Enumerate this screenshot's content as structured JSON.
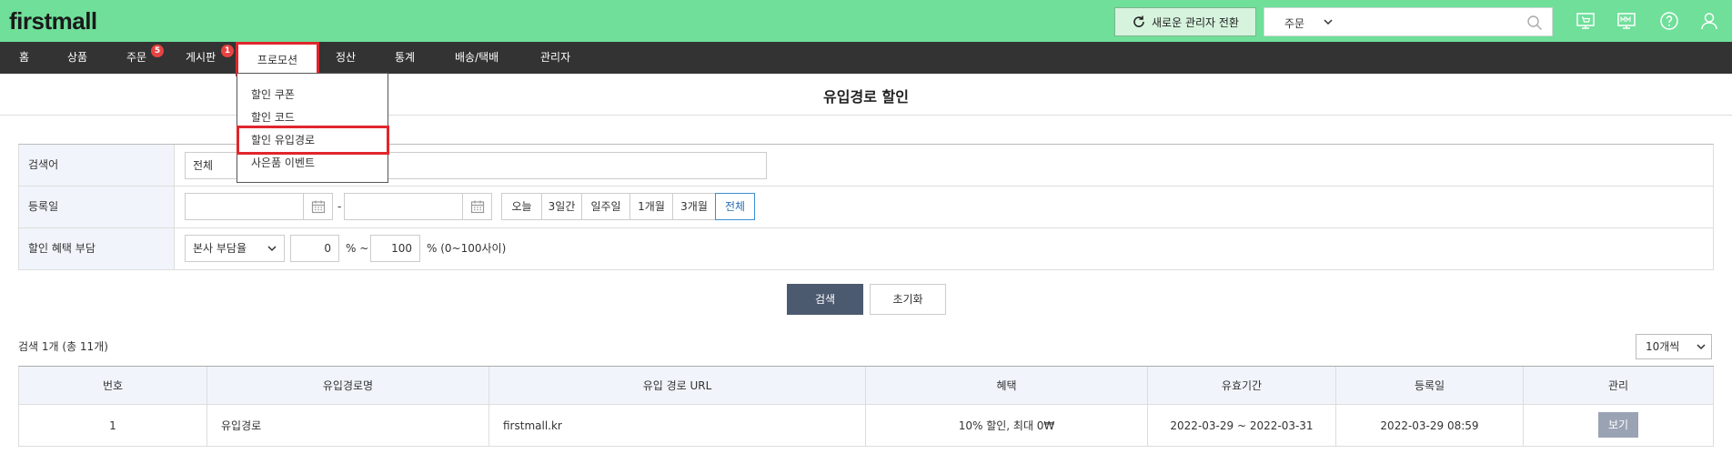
{
  "header": {
    "logo": "firstmall",
    "switch_button": "새로운 관리자 전환",
    "search": {
      "selected": "주문",
      "placeholder": ""
    }
  },
  "nav": {
    "items": [
      {
        "label": "홈"
      },
      {
        "label": "상품"
      },
      {
        "label": "주문",
        "badge": "5"
      },
      {
        "label": "게시판",
        "badge": "1"
      },
      {
        "label": "프로모션"
      },
      {
        "label": "정산"
      },
      {
        "label": "통계"
      },
      {
        "label": "배송/택배"
      },
      {
        "label": "관리자"
      }
    ]
  },
  "dropdown": {
    "items": [
      "할인 쿠폰",
      "할인 코드",
      "할인 유입경로",
      "사은품 이벤트"
    ]
  },
  "page": {
    "title": "유입경로 할인"
  },
  "form": {
    "keyword": {
      "label": "검색어",
      "select_value": "전체"
    },
    "date": {
      "label": "등록일",
      "separator": "-",
      "buttons": [
        "오늘",
        "3일간",
        "일주일",
        "1개월",
        "3개월",
        "전체"
      ],
      "active": "전체"
    },
    "benefit": {
      "label": "할인 혜택 부담",
      "select_value": "본사 부담율",
      "min": "0",
      "range_sep": "% ~",
      "max": "100",
      "hint": "% (0~100사이)"
    }
  },
  "buttons": {
    "search": "검색",
    "reset": "초기화"
  },
  "results": {
    "count_text": "검색 1개 (총 11개)",
    "per_page": "10개씩"
  },
  "table": {
    "headers": [
      "번호",
      "유입경로명",
      "유입 경로 URL",
      "혜택",
      "유효기간",
      "등록일",
      "관리"
    ],
    "rows": [
      {
        "no": "1",
        "name": "유입경로",
        "url": "firstmall.kr",
        "benefit": "10% 할인, 최대 0₩",
        "period": "2022-03-29 ~ 2022-03-31",
        "registered": "2022-03-29 08:59",
        "action": "보기"
      }
    ]
  },
  "colors": {
    "header_bg": "#6fdf9a",
    "nav_bg": "#333333",
    "highlight": "#e0262c",
    "search_button": "#4c5a70"
  }
}
